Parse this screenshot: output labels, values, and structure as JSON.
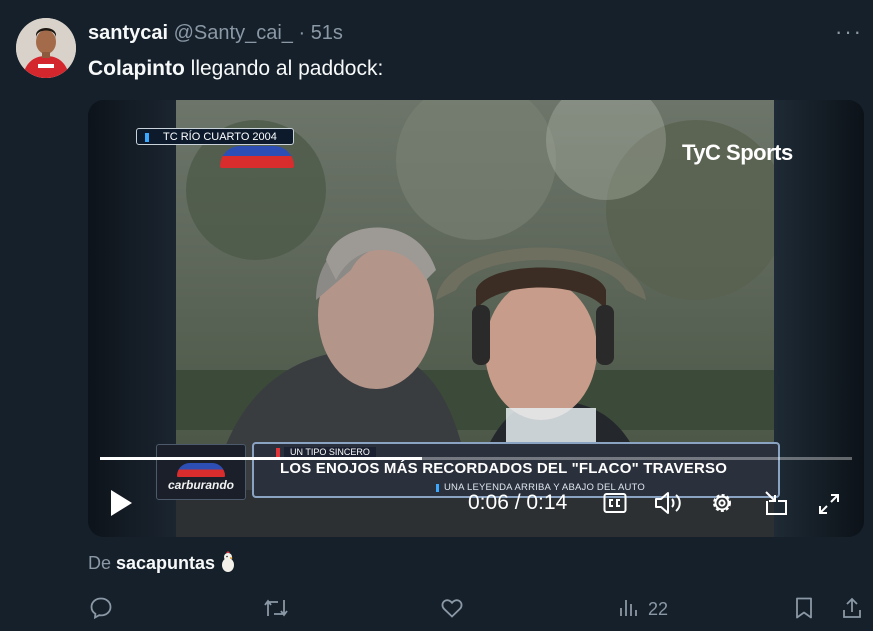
{
  "tweet": {
    "display_name": "santycai",
    "handle": "@Santy_cai_",
    "separator": "·",
    "time": "51s",
    "more": "···",
    "text_bold": "Colapinto",
    "text_rest": " llegando al paddock:"
  },
  "video": {
    "overlay_badge": "TC RÍO CUARTO 2004",
    "brand": "TyC Sports",
    "lower_third": {
      "logo": "carburando",
      "kicker": "UN TIPO SINCERO",
      "title": "LOS ENOJOS MÁS RECORDADOS DEL \"FLACO\" TRAVERSO",
      "subtitle": "UNA LEYENDA ARRIBA Y ABAJO DEL AUTO"
    },
    "time_display": "0:06 / 0:14",
    "elapsed_seconds": 6,
    "duration_seconds": 14
  },
  "source": {
    "prefix": "De ",
    "name": "sacapuntas"
  },
  "actions": {
    "views_count": "22"
  },
  "colors": {
    "background": "#15202b",
    "text_primary": "#f7f9f9",
    "text_secondary": "#8b98a5"
  },
  "icons": [
    "more-icon",
    "play-icon",
    "closed-captions-icon",
    "volume-icon",
    "settings-gear-icon",
    "dock-icon",
    "fullscreen-icon",
    "chick-emoji-icon",
    "reply-icon",
    "retweet-icon",
    "like-icon",
    "views-icon",
    "bookmark-icon",
    "share-icon"
  ]
}
